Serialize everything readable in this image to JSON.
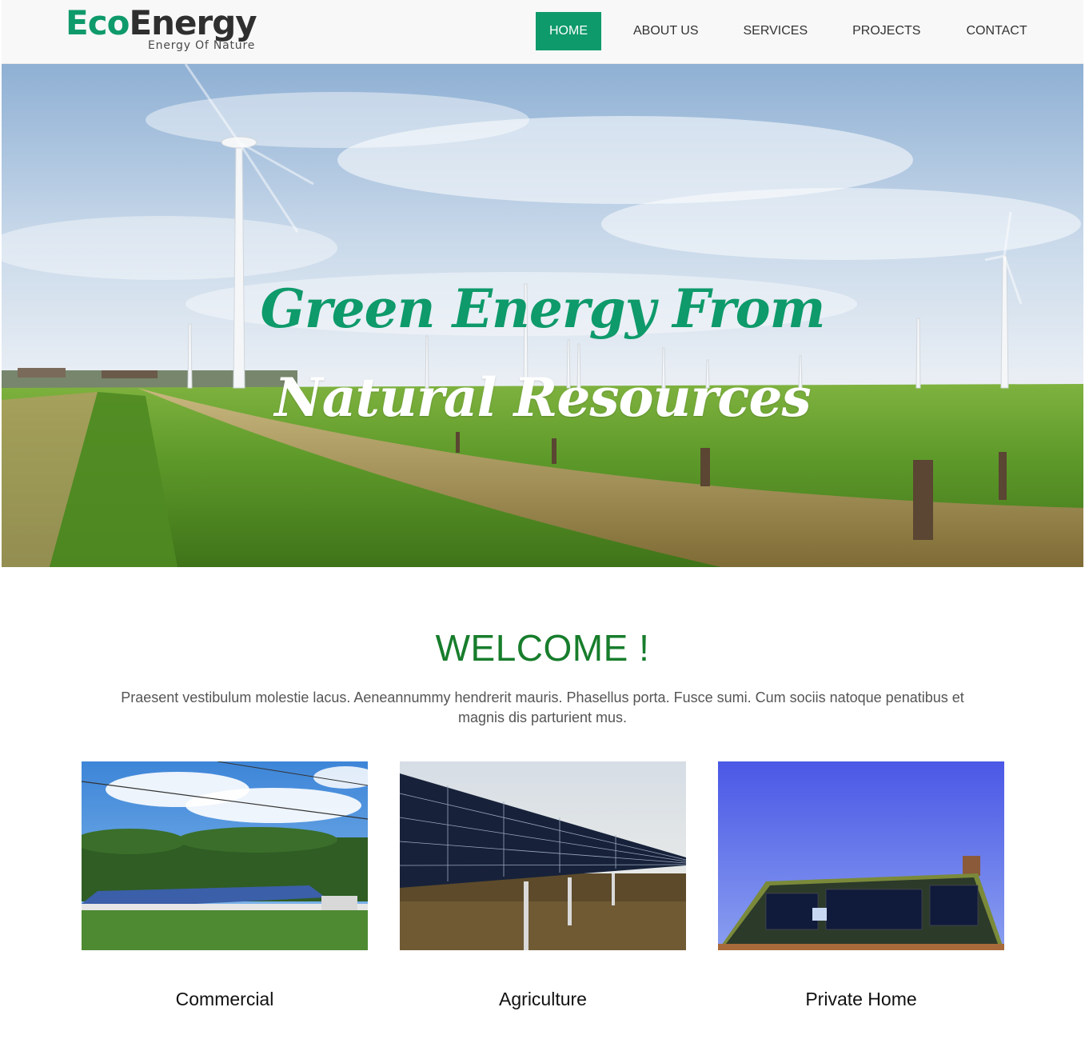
{
  "brand": {
    "logo_part1": "Eco",
    "logo_part2": "Energy",
    "tagline": "Energy Of Nature",
    "accent_color": "#0e9a6a",
    "heading_color": "#177d2c"
  },
  "nav": {
    "items": [
      {
        "label": "HOME",
        "active": true
      },
      {
        "label": "ABOUT US",
        "active": false
      },
      {
        "label": "SERVICES",
        "active": false
      },
      {
        "label": "PROJECTS",
        "active": false
      },
      {
        "label": "CONTACT",
        "active": false
      }
    ]
  },
  "hero": {
    "line1": "Green Energy From",
    "line2": "Natural Resources",
    "image": "wind-turbines-field-photo"
  },
  "welcome": {
    "title": "WELCOME !",
    "text": "Praesent vestibulum molestie lacus. Aeneannummy hendrerit mauris. Phasellus porta. Fusce sumi. Cum sociis natoque penatibus et magnis dis parturient mus."
  },
  "cards": [
    {
      "title": "Commercial",
      "image": "solar-roof-barn-photo"
    },
    {
      "title": "Agriculture",
      "image": "solar-panel-array-photo"
    },
    {
      "title": "Private Home",
      "image": "solar-house-roof-photo"
    }
  ]
}
